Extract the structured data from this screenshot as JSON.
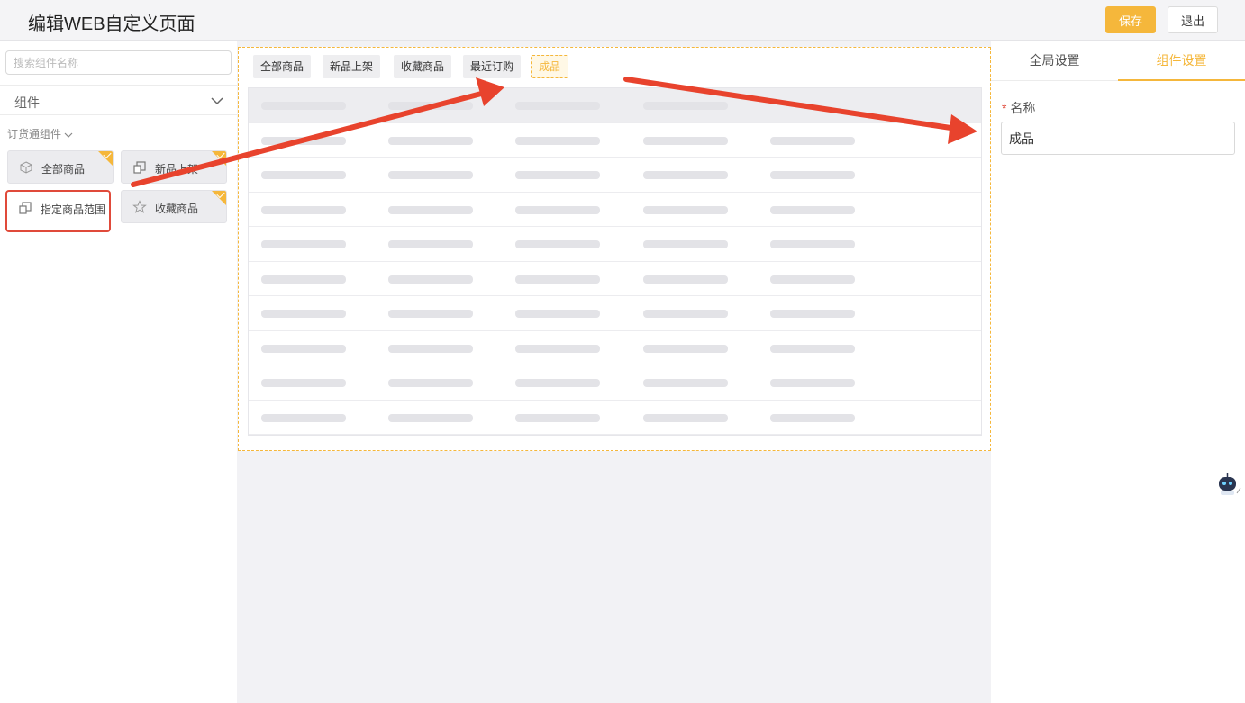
{
  "header": {
    "title": "编辑WEB自定义页面",
    "save_label": "保存",
    "exit_label": "退出"
  },
  "left": {
    "search_placeholder": "搜索组件名称",
    "group_label": "组件",
    "sub_label": "订货通组件",
    "components": [
      {
        "label": "全部商品",
        "icon": "box-icon",
        "badge": true
      },
      {
        "label": "新品上架",
        "icon": "new-item-icon",
        "badge": true
      },
      {
        "label": "指定商品范围",
        "icon": "range-icon",
        "badge": false,
        "selected": true
      },
      {
        "label": "收藏商品",
        "icon": "star-icon",
        "badge": true
      }
    ]
  },
  "canvas": {
    "tabs": [
      {
        "label": "全部商品"
      },
      {
        "label": "新品上架"
      },
      {
        "label": "收藏商品"
      },
      {
        "label": "最近订购"
      },
      {
        "label": "成品",
        "active": true
      }
    ]
  },
  "right": {
    "tabs": [
      {
        "label": "全局设置"
      },
      {
        "label": "组件设置",
        "active": true
      }
    ],
    "field_label": "名称",
    "field_value": "成品"
  },
  "colors": {
    "accent": "#f5b73b",
    "highlight": "#e04a3a",
    "arrow": "#e8432d"
  }
}
